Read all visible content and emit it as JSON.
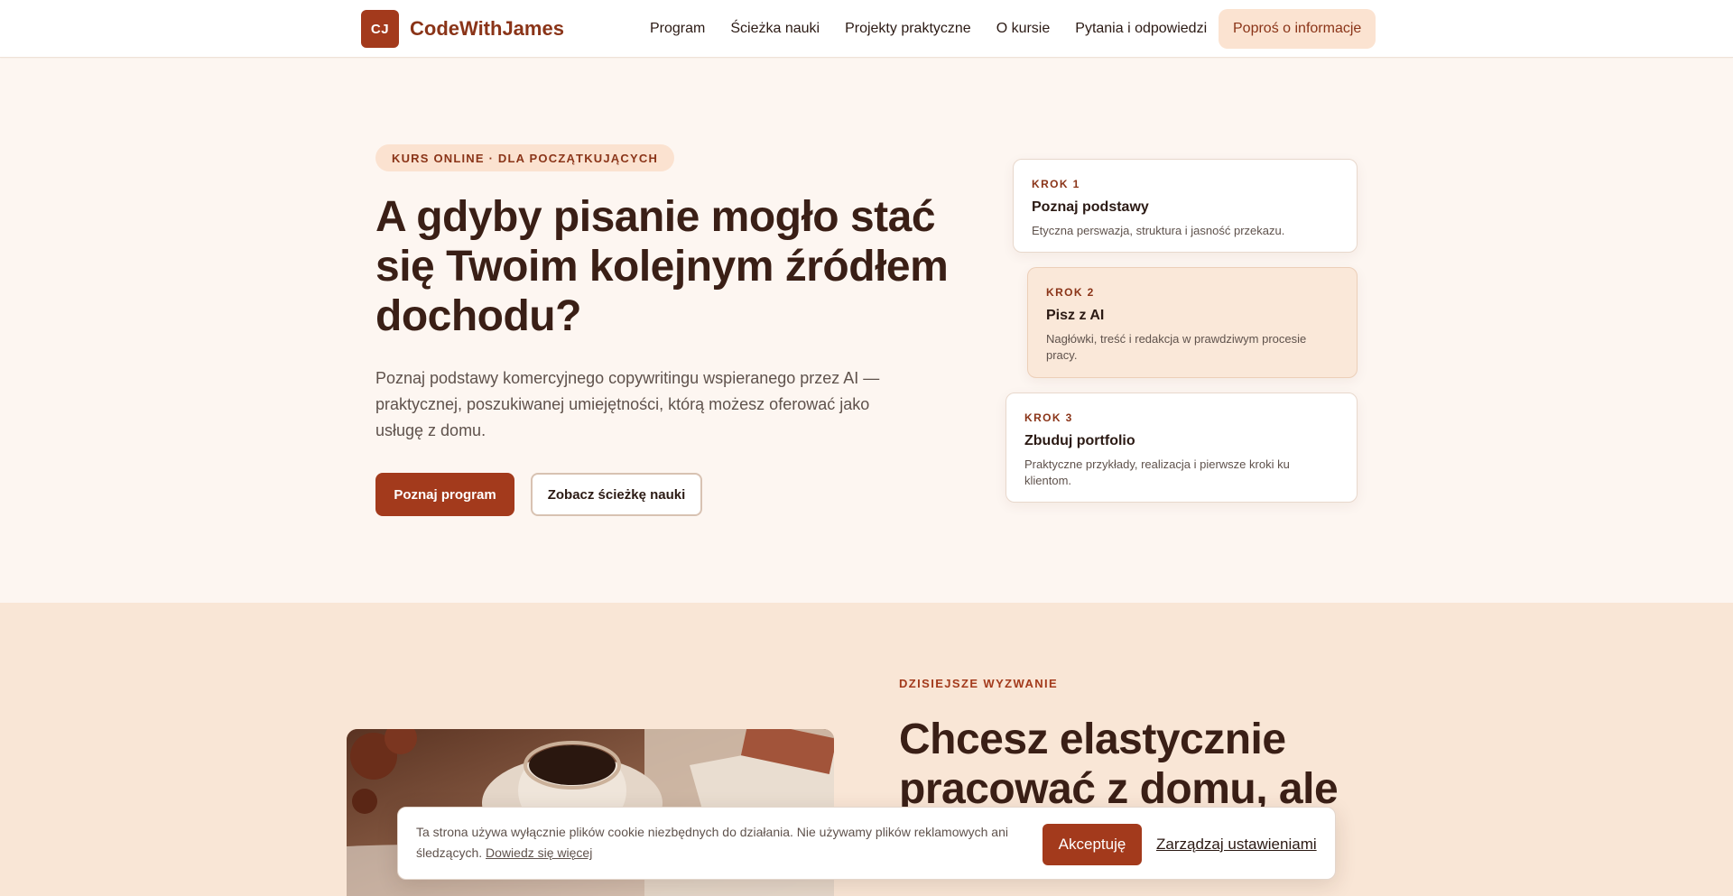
{
  "header": {
    "logo_initials": "CJ",
    "brand": "CodeWithJames",
    "nav": [
      "Program",
      "Ścieżka nauki",
      "Projekty praktyczne",
      "O kursie",
      "Pytania i odpowiedzi"
    ],
    "cta": "Poproś o informacje"
  },
  "hero": {
    "pill": "KURS ONLINE · DLA POCZĄTKUJĄCYCH",
    "title": "A gdyby pisanie mogło stać się Twoim kolejnym źródłem dochodu?",
    "subtitle": "Poznaj podstawy komercyjnego copywritingu wspieranego przez AI — praktycznej, poszukiwanej umiejętności, którą możesz oferować jako usługę z domu.",
    "primary_button": "Poznaj program",
    "secondary_button": "Zobacz ścieżkę nauki",
    "steps": [
      {
        "kicker": "KROK 1",
        "title": "Poznaj podstawy",
        "desc": "Etyczna perswazja, struktura i jasność przekazu."
      },
      {
        "kicker": "KROK 2",
        "title": "Pisz z AI",
        "desc": "Nagłówki, treść i redakcja w prawdziwym procesie pracy."
      },
      {
        "kicker": "KROK 3",
        "title": "Zbuduj portfolio",
        "desc": "Praktyczne przykłady, realizacja i pierwsze kroki ku klientom."
      }
    ]
  },
  "challenge": {
    "kicker": "DZISIEJSZE WYZWANIE",
    "title": "Chcesz elastycznie pracować z domu, ale wybrać?"
  },
  "cookie": {
    "text": "Ta strona używa wyłącznie plików cookie niezbędnych do działania. Nie używamy plików reklamowych ani śledzących.",
    "link": "Dowiedz się więcej",
    "accept": "Akceptuję",
    "manage": "Zarządzaj ustawieniami"
  },
  "colors": {
    "accent": "#a33a1c",
    "hero_bg": "#fdf6f1",
    "section_bg": "#f9e6d6"
  }
}
